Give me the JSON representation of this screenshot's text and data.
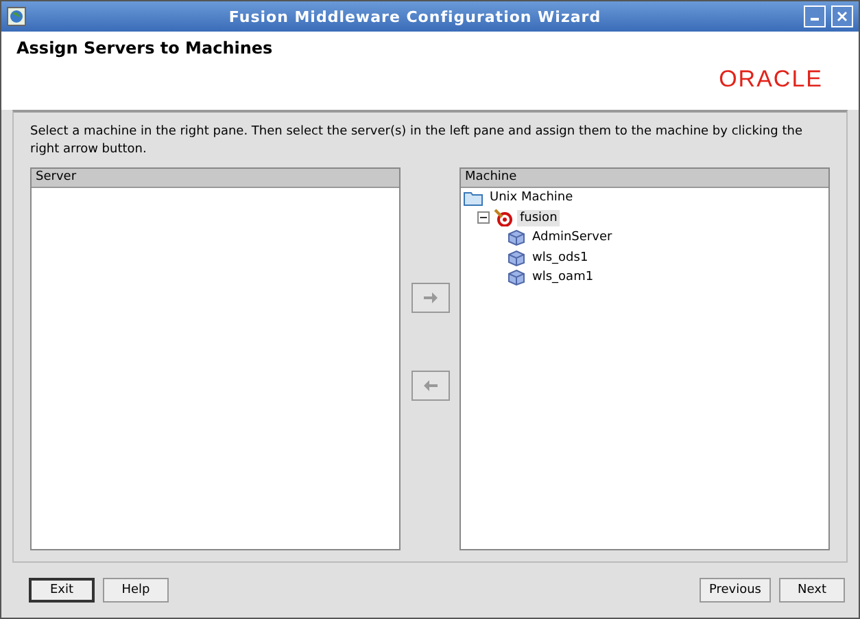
{
  "window": {
    "title": "Fusion Middleware Configuration Wizard"
  },
  "header": {
    "title": "Assign Servers to Machines",
    "logo": "ORACLE"
  },
  "instructions": "Select a machine in the right pane. Then select the server(s) in the left pane and assign them to the machine by clicking the right arrow button.",
  "server_pane": {
    "heading": "Server"
  },
  "assign_buttons": [
    {
      "kind": "right",
      "disabled": true
    },
    {
      "kind": "left",
      "disabled": true
    }
  ],
  "machine_pane": {
    "heading": "Machine",
    "tree": [
      {
        "label": "Unix Machine",
        "kind": "folder",
        "selected": false,
        "children": [
          {
            "label": "fusion",
            "kind": "machine",
            "expanded": true,
            "selected": true,
            "children": [
              {
                "label": "AdminServer",
                "kind": "server",
                "selected": false
              },
              {
                "label": "wls_ods1",
                "kind": "server",
                "selected": false
              },
              {
                "label": "wls_oam1",
                "kind": "server",
                "selected": false
              }
            ]
          }
        ]
      }
    ]
  },
  "footer": {
    "left": [
      {
        "label": "Exit",
        "default": true
      },
      {
        "label": "Help",
        "default": false
      }
    ],
    "right": [
      {
        "label": "Previous",
        "default": false
      },
      {
        "label": "Next",
        "default": false
      }
    ]
  }
}
